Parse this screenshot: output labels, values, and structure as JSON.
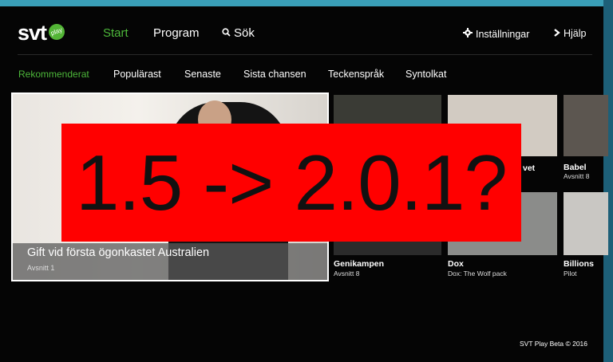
{
  "header": {
    "logo_text": "svt",
    "logo_badge": "play",
    "nav": {
      "start": "Start",
      "program": "Program",
      "search": "Sök",
      "settings": "Inställningar",
      "help": "Hjälp"
    }
  },
  "subnav": [
    "Rekommenderat",
    "Populärast",
    "Senaste",
    "Sista chansen",
    "Teckenspråk",
    "Syntolkat"
  ],
  "hero": {
    "title": "Gift vid första ögonkastet Australien",
    "subtitle": "Avsnitt 1"
  },
  "tiles": [
    {
      "title": "Babel",
      "subtitle": "Avsnitt 8"
    },
    {
      "title": "Genikampen",
      "subtitle": "Avsnitt 8"
    },
    {
      "title": "Dox",
      "subtitle": "Dox: The Wolf pack"
    },
    {
      "title": "Billions",
      "subtitle": "Pilot"
    }
  ],
  "partial_tile_label": "vet",
  "overlay_text": "1.5 -> 2.0.1?",
  "footer": "SVT Play Beta © 2016",
  "colors": {
    "accent_green": "#4db83a",
    "overlay_red": "#ff0000",
    "background": "#050505"
  },
  "icons": {
    "search": "search-icon",
    "settings": "gear-icon",
    "help": "chevron-right-icon"
  }
}
